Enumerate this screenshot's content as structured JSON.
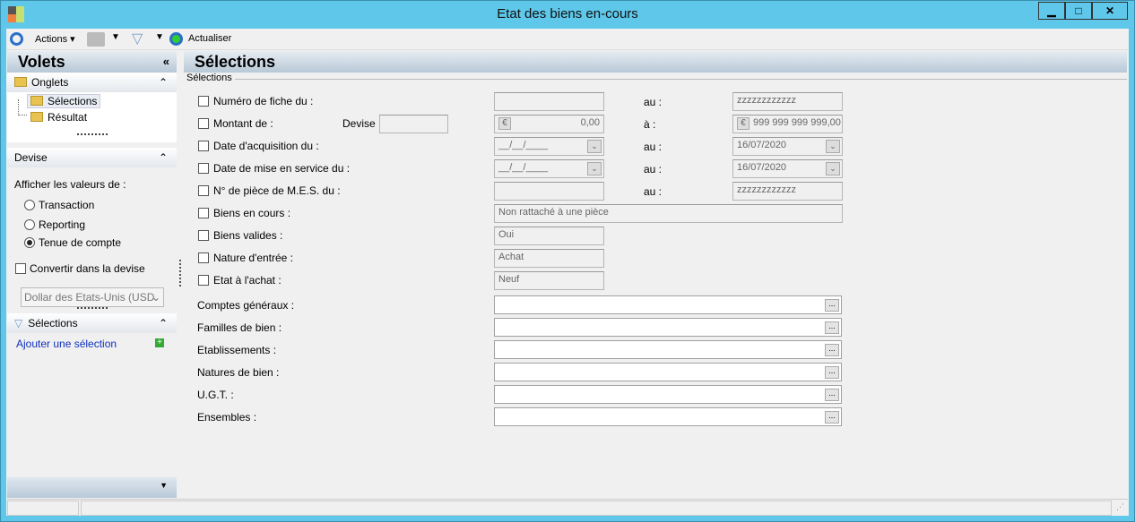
{
  "window": {
    "title": "Etat des biens en-cours",
    "min": "▁",
    "max": "□",
    "close": "✕"
  },
  "toolbar": {
    "actions": "Actions",
    "refresh": "Actualiser"
  },
  "left": {
    "title": "Volets",
    "collapse": "«",
    "onglets": {
      "title": "Onglets",
      "items": [
        "Sélections",
        "Résultat"
      ]
    },
    "devise": {
      "title": "Devise",
      "show_label": "Afficher les valeurs de :",
      "options": [
        "Transaction",
        "Reporting",
        "Tenue de compte"
      ],
      "selected": 2,
      "convert_label": "Convertir dans la devise",
      "currency": "Dollar des Etats-Unis (USD"
    },
    "selections": {
      "title": "Sélections",
      "add": "Ajouter une sélection"
    }
  },
  "main": {
    "title": "Sélections",
    "group": "Sélections",
    "rows": [
      {
        "label": "Numéro de fiche du :",
        "to": "au :",
        "from_val": "",
        "to_val": "zzzzzzzzzzzz"
      },
      {
        "label": "Montant de :",
        "devise": "Devise :",
        "to": "à :",
        "from_val": "0,00",
        "to_val": "999 999 999 999,00"
      },
      {
        "label": "Date d'acquisition du :",
        "to": "au :",
        "from_val": "__/__/____",
        "to_val": "16/07/2020"
      },
      {
        "label": "Date de mise en service du :",
        "to": "au :",
        "from_val": "__/__/____",
        "to_val": "16/07/2020"
      },
      {
        "label": "N° de pièce de M.E.S. du :",
        "to": "au :",
        "from_val": "",
        "to_val": "zzzzzzzzzzzz"
      }
    ],
    "singles": [
      {
        "label": "Biens en cours :",
        "val": "Non rattaché à une pièce"
      },
      {
        "label": "Biens valides :",
        "val": "Oui"
      },
      {
        "label": "Nature d'entrée :",
        "val": "Achat"
      },
      {
        "label": "Etat à l'achat :",
        "val": "Neuf"
      }
    ],
    "lookups": [
      "Comptes généraux :",
      "Familles de bien :",
      "Etablissements :",
      "Natures de bien :",
      "U.G.T. :",
      "Ensembles :"
    ],
    "ellipsis": "..."
  }
}
